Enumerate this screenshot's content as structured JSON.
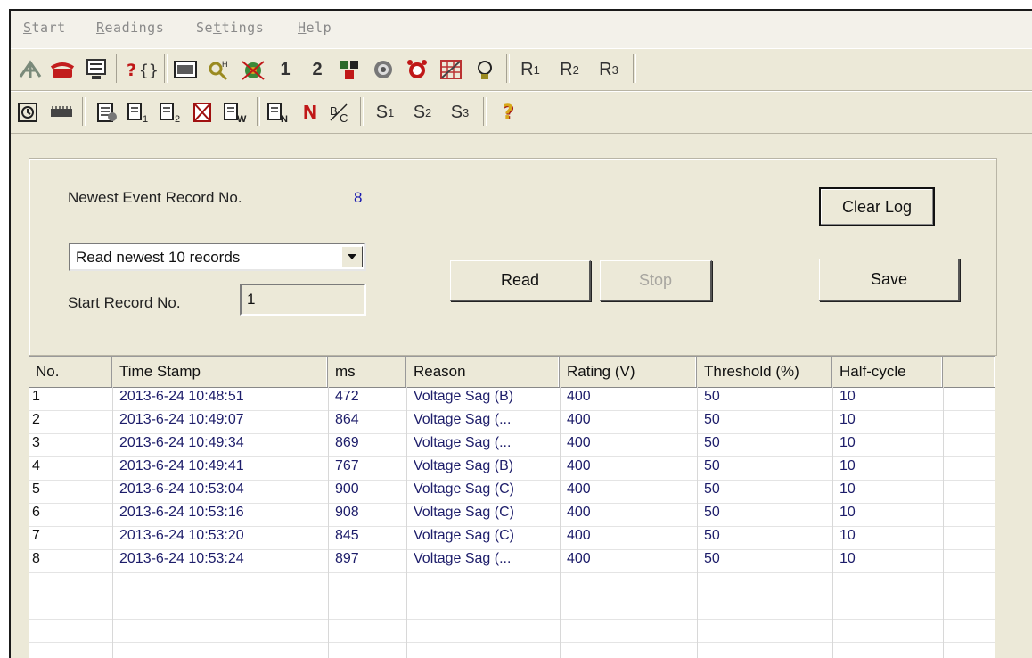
{
  "menu": {
    "items": [
      {
        "pre": "",
        "key": "S",
        "post": "tart"
      },
      {
        "pre": "",
        "key": "R",
        "post": "eadings"
      },
      {
        "pre": "Se",
        "key": "t",
        "post": "tings"
      },
      {
        "pre": "",
        "key": "H",
        "post": "elp"
      }
    ]
  },
  "toolbar1": {
    "text_buttons": [
      "1",
      "2"
    ],
    "r_buttons": [
      {
        "letter": "R",
        "sub": "1"
      },
      {
        "letter": "R",
        "sub": "2"
      },
      {
        "letter": "R",
        "sub": "3"
      }
    ],
    "icons": [
      "antenna-icon",
      "phone-icon",
      "terminal-icon",
      "help-query-icon",
      "display-icon",
      "key-icon",
      "network-icon",
      "transfer-icon",
      "target-icon",
      "alarm-clock-icon",
      "harmonic-chart-icon",
      "bulb-icon"
    ]
  },
  "toolbar2": {
    "s_buttons": [
      {
        "letter": "S",
        "sub": "1"
      },
      {
        "letter": "S",
        "sub": "2"
      },
      {
        "letter": "S",
        "sub": "3"
      }
    ],
    "help_label": "?",
    "n_label": "N",
    "icons": [
      "clock-icon",
      "memory-icon",
      "record-icon",
      "record-b1-icon",
      "record-b2-icon",
      "record-delete-icon",
      "record-w-icon",
      "record-n-icon",
      "record-c-icon"
    ]
  },
  "panel": {
    "newest_label": "Newest Event Record No.",
    "newest_value": "8",
    "select_value": "Read newest 10 records",
    "start_label": "Start Record No.",
    "start_value": "1",
    "read_label": "Read",
    "stop_label": "Stop",
    "clear_label": "Clear Log",
    "save_label": "Save"
  },
  "table": {
    "headers": [
      "No.",
      "Time Stamp",
      "ms",
      "Reason",
      "Rating (V)",
      "Threshold (%)",
      "Half-cycle",
      ""
    ],
    "rows": [
      [
        "1",
        "2013-6-24 10:48:51",
        "472",
        "Voltage Sag (B)",
        "400",
        "50",
        "10"
      ],
      [
        "2",
        "2013-6-24 10:49:07",
        "864",
        "Voltage Sag (...",
        "400",
        "50",
        "10"
      ],
      [
        "3",
        "2013-6-24 10:49:34",
        "869",
        "Voltage Sag (...",
        "400",
        "50",
        "10"
      ],
      [
        "4",
        "2013-6-24 10:49:41",
        "767",
        "Voltage Sag (B)",
        "400",
        "50",
        "10"
      ],
      [
        "5",
        "2013-6-24 10:53:04",
        "900",
        "Voltage Sag (C)",
        "400",
        "50",
        "10"
      ],
      [
        "6",
        "2013-6-24 10:53:16",
        "908",
        "Voltage Sag (C)",
        "400",
        "50",
        "10"
      ],
      [
        "7",
        "2013-6-24 10:53:20",
        "845",
        "Voltage Sag (C)",
        "400",
        "50",
        "10"
      ],
      [
        "8",
        "2013-6-24 10:53:24",
        "897",
        "Voltage Sag (...",
        "400",
        "50",
        "10"
      ]
    ]
  }
}
